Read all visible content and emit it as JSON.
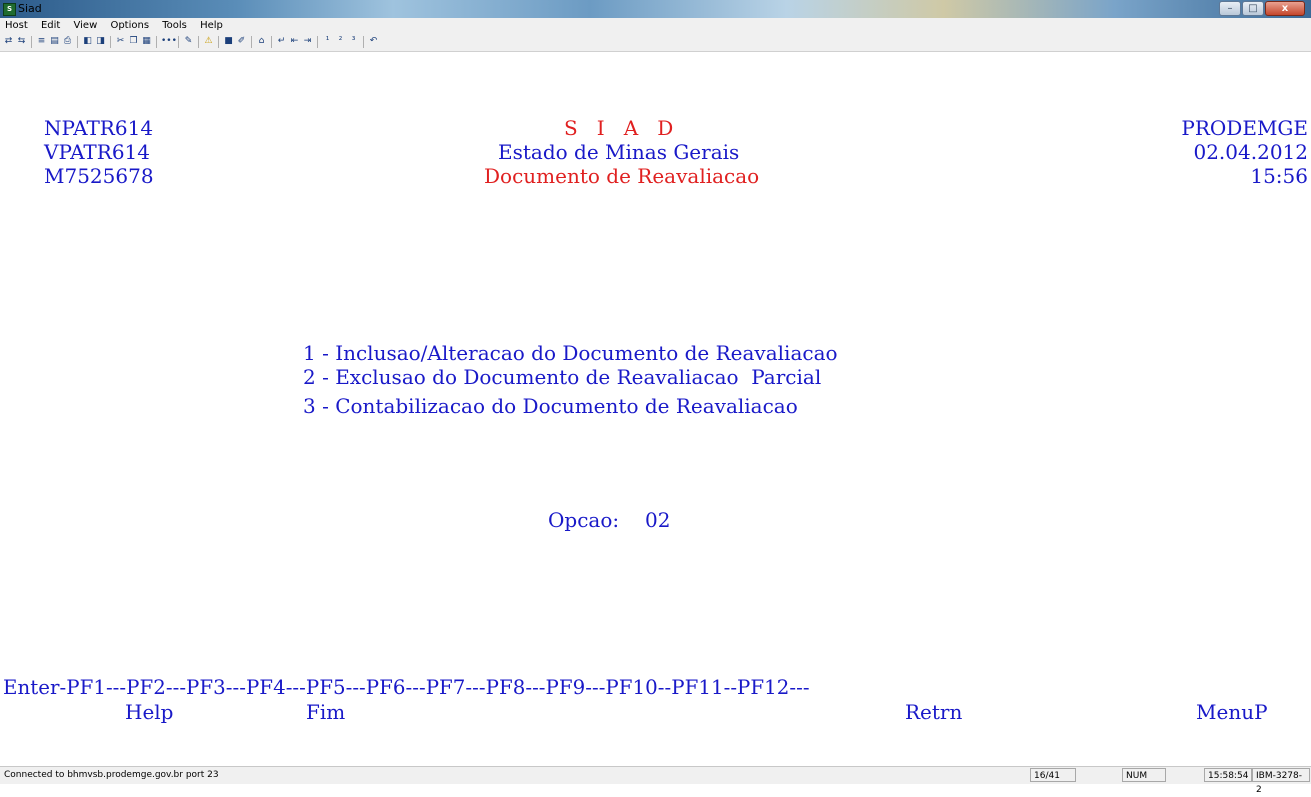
{
  "window": {
    "title": "Siad",
    "app_icon": "S",
    "controls": {
      "minimize": "–",
      "maximize": "□",
      "close": "x"
    }
  },
  "menu": [
    "Host",
    "Edit",
    "View",
    "Options",
    "Tools",
    "Help"
  ],
  "toolbar_icons": [
    "connect-icon",
    "disconnect-icon",
    "send-icon",
    "receive-icon",
    "print-icon",
    "copy-screen-icon",
    "paste-screen-icon",
    "cut-icon",
    "copy-icon",
    "paste-icon",
    "dots-icon",
    "macro-icon",
    "alert-icon",
    "display-icon",
    "pen-icon",
    "home-icon",
    "enter-icon",
    "backtab-icon",
    "tab-icon",
    "pa1-icon",
    "pa2-icon",
    "pa3-icon",
    "undo-icon"
  ],
  "screen": {
    "header_left": [
      "NPATR614",
      "VPATR614",
      "M7525678"
    ],
    "header_center": {
      "system": "S   I   A   D",
      "state": "Estado de Minas Gerais",
      "subtitle": "Documento de Reavaliacao"
    },
    "header_right": [
      "PRODEMGE",
      "02.04.2012",
      "15:56"
    ],
    "options": [
      "1 - Inclusao/Alteracao do Documento de Reavaliacao",
      "2 - Exclusao do Documento de Reavaliacao  Parcial",
      "3 - Contabilizacao do Documento de Reavaliacao"
    ],
    "opcao_label": "Opcao:",
    "opcao_value": "02",
    "pf_keys_line": "Enter-PF1---PF2---PF3---PF4---PF5---PF6---PF7---PF8---PF9---PF10--PF11--PF12---",
    "pf_labels": {
      "pf1": "Help",
      "pf3": "Fim",
      "pf9": "Retrn",
      "pf12": "MenuP"
    }
  },
  "status": {
    "connection": "Connected to bhmvsb.prodemge.gov.br port 23",
    "cursor": "16/41",
    "num": "NUM",
    "clock": "15:58:54",
    "terminal": "IBM-3278-2"
  },
  "colors": {
    "terminal_text": "#1919c8",
    "highlight_text": "#e02020",
    "background": "#ffffff"
  }
}
